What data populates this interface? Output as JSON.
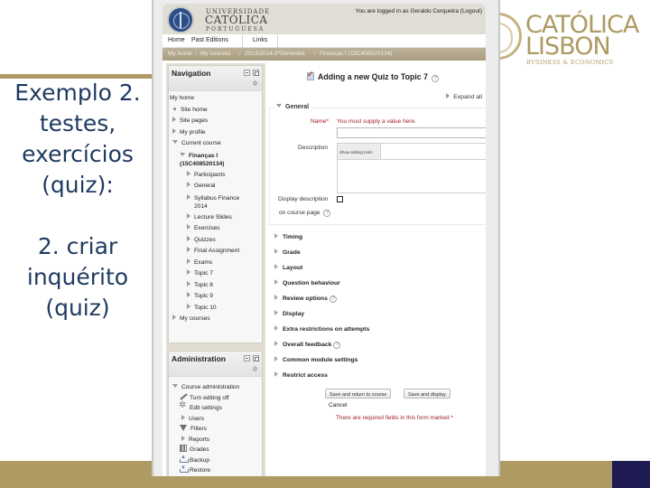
{
  "slide": {
    "text_lines": [
      "Exemplo 2.",
      "testes,",
      "exercícios",
      "(quiz):",
      "",
      "2. criar",
      "inquérito",
      "(quiz)"
    ],
    "logo": {
      "line1": "CATÓLICA",
      "line2": "LISBON",
      "subtitle": "BVSINESS & ECONOMICS"
    },
    "colors": {
      "gold": "#ad9b63",
      "navy": "#1e1a52",
      "text": "#1f3a5f"
    }
  },
  "moodle": {
    "header": {
      "institution": [
        "UNIVERSIDADE",
        "CATÓLICA",
        "PORTUGUESA"
      ],
      "login_prefix": "You are logged in as Geraldo Cerqueira",
      "logout_label": "(Logout)"
    },
    "menu": [
      "Home",
      "Past Editions",
      "Links"
    ],
    "breadcrumb": [
      "My home",
      "My courses",
      "2013/2014-2ºSemestre",
      "Finanças I (15C408520134)"
    ],
    "breadcrumb_sep": "/",
    "navigation": {
      "title": "Navigation",
      "my_home": "My home",
      "site_home": "Site home",
      "site_pages": "Site pages",
      "my_profile": "My profile",
      "current_course": "Current course",
      "course_name": "Finanças I",
      "course_code": "(15C408520134)",
      "sections": [
        "Participants",
        "General",
        "Syllabus Finance 2014",
        "Lecture Slides",
        "Exercises",
        "Quizzes",
        "Final Assignment",
        "Exams",
        "Topic 7",
        "Topic 8",
        "Topic 9",
        "Topic 10"
      ],
      "my_courses": "My courses"
    },
    "administration": {
      "title": "Administration",
      "course_admin": "Course administration",
      "items": [
        {
          "label": "Turn editing off",
          "icon": "pencil-icon"
        },
        {
          "label": "Edit settings",
          "icon": "gear-icon"
        },
        {
          "label": "Users",
          "icon": "expand-arrow-icon"
        },
        {
          "label": "Filters",
          "icon": "filter-icon"
        },
        {
          "label": "Reports",
          "icon": "expand-arrow-icon"
        },
        {
          "label": "Grades",
          "icon": "grades-icon"
        },
        {
          "label": "Backup",
          "icon": "backup-icon"
        },
        {
          "label": "Restore",
          "icon": "restore-icon"
        }
      ]
    },
    "form": {
      "title": "Adding a new Quiz to Topic 7",
      "help_glyph": "?",
      "expand_all": "Expand all",
      "general_legend": "General",
      "name_label": "Name",
      "required_mark": "*",
      "name_error": "You must supply a value here.",
      "name_value": "",
      "description_label": "Description",
      "show_editing_tools": "Show editing tools",
      "display_description_label": "Display description",
      "display_description_label2": "on course page",
      "display_description_checked": false,
      "sections": [
        "Timing",
        "Grade",
        "Layout",
        "Question behaviour",
        "Review options",
        "Display",
        "Extra restrictions on attempts",
        "Overall feedback",
        "Common module settings",
        "Restrict access"
      ],
      "save_return": "Save and return to course",
      "save_display": "Save and display",
      "cancel": "Cancel",
      "required_note": "There are required fields in this form marked"
    }
  }
}
